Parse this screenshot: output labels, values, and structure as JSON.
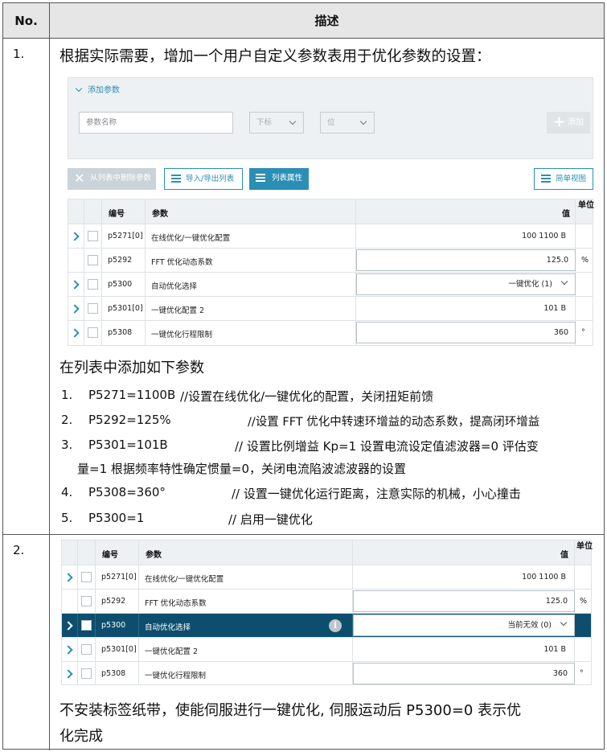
{
  "header": {
    "no": "No.",
    "desc": "描述"
  },
  "step1": {
    "num": "1.",
    "intro": "根据实际需要，增加一个用户自定义参数表用于优化参数的设置：",
    "panel": {
      "add_title": "添加参数",
      "name_placeholder": "参数名称",
      "index_select": "下标",
      "bit_select": "位",
      "add_button": "添加",
      "remove_button": "从列表中删除参数",
      "import_button": "导入/导出列表",
      "props_button": "列表属性",
      "simple_button": "简单视图"
    },
    "table": {
      "headers": {
        "id": "编号",
        "param": "参数",
        "value": "值",
        "unit": "单位"
      },
      "rows": [
        {
          "id": "p5271[0]",
          "param": "在线优化/一键优化配置",
          "value": "100 1100 B",
          "unit": ""
        },
        {
          "id": "p5292",
          "param": "FFT 优化动态系数",
          "value": "125.0",
          "unit": "%"
        },
        {
          "id": "p5300",
          "param": "自动优化选择",
          "value": "一键优化 (1)",
          "unit": ""
        },
        {
          "id": "p5301[0]",
          "param": "一键优化配置 2",
          "value": "101 B",
          "unit": ""
        },
        {
          "id": "p5308",
          "param": "一键优化行程限制",
          "value": "360",
          "unit": "°"
        }
      ]
    },
    "list_title": "在列表中添加如下参数",
    "items": [
      {
        "n": "1.",
        "param": "P5271=1100B",
        "comment": "//设置在线优化/一键优化的配置，关闭扭矩前馈"
      },
      {
        "n": "2.",
        "param": "P5292=125%",
        "comment": "//设置 FFT 优化中转速环增益的动态系数，提高闭环增益"
      },
      {
        "n": "3.",
        "param": "P5301=101B",
        "comment": "// 设置比例增益 Kp=1 设置电流设定值滤波器=0 评估变",
        "cont": "量=1 根据频率特性确定惯量=0，关闭电流陷波滤波器的设置"
      },
      {
        "n": "4.",
        "param": "P5308=360°",
        "comment": "// 设置一键优化运行距离，注意实际的机械，小心撞击"
      },
      {
        "n": "5.",
        "param": "P5300=1",
        "comment": "// 启用一键优化"
      }
    ]
  },
  "step2": {
    "num": "2.",
    "table": {
      "headers": {
        "id": "编号",
        "param": "参数",
        "value": "值",
        "unit": "单位"
      },
      "rows": [
        {
          "id": "p5271[0]",
          "param": "在线优化/一键优化配置",
          "value": "100 1100 B",
          "unit": ""
        },
        {
          "id": "p5292",
          "param": "FFT 优化动态系数",
          "value": "125.0",
          "unit": "%"
        },
        {
          "id": "p5300",
          "param": "自动优化选择",
          "value": "当前无效 (0)",
          "unit": ""
        },
        {
          "id": "p5301[0]",
          "param": "一键优化配置 2",
          "value": "101 B",
          "unit": ""
        },
        {
          "id": "p5308",
          "param": "一键优化行程限制",
          "value": "360",
          "unit": "°"
        }
      ]
    },
    "note_line1": "不安装标签纸带，使能伺服进行一键优化, 伺服运动后 P5300=0 表示优",
    "note_line2": "化完成"
  },
  "colors": {
    "accent": "#2b8fb5",
    "selected_row": "#0d4e6e",
    "header_bg": "#e6e6e6"
  }
}
